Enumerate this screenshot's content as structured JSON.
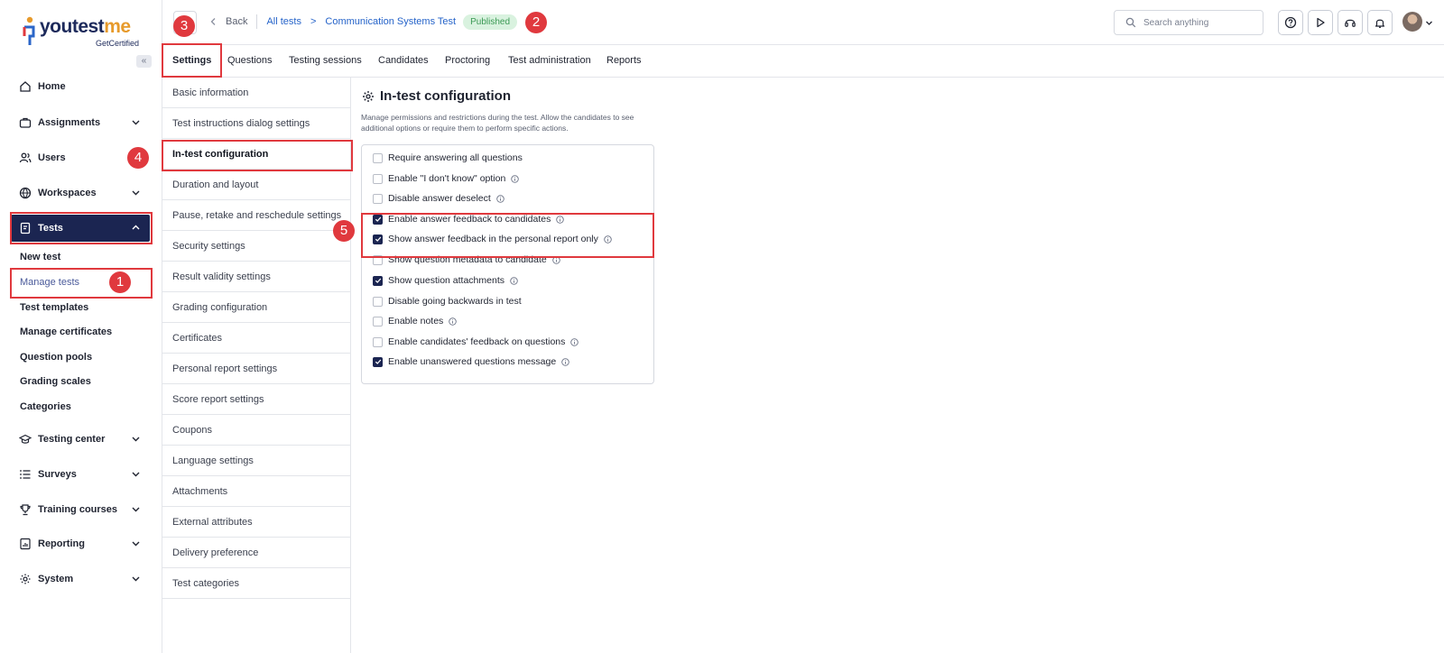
{
  "logo": {
    "brand_prefix": "youtest",
    "brand_suffix": "me",
    "tagline": "GetCertified"
  },
  "sidebar": {
    "collapse_symbol": "«",
    "items": [
      {
        "label": "Home",
        "icon": "home-icon"
      },
      {
        "label": "Assignments",
        "icon": "briefcase-icon"
      },
      {
        "label": "Users",
        "icon": "users-icon"
      },
      {
        "label": "Workspaces",
        "icon": "globe-icon"
      },
      {
        "label": "Tests",
        "icon": "document-icon"
      },
      {
        "label": "Testing center",
        "icon": "graduation-cap-icon"
      },
      {
        "label": "Surveys",
        "icon": "list-icon"
      },
      {
        "label": "Training courses",
        "icon": "trophy-icon"
      },
      {
        "label": "Reporting",
        "icon": "report-icon"
      },
      {
        "label": "System",
        "icon": "gear-icon"
      }
    ],
    "tests_sub": [
      "New test",
      "Manage tests",
      "Test templates",
      "Manage certificates",
      "Question pools",
      "Grading scales",
      "Categories"
    ]
  },
  "topbar": {
    "back": "Back",
    "crumb_all": "All tests",
    "crumb_sep": ">",
    "crumb_test": "Communication Systems Test",
    "status": "Published",
    "search_placeholder": "Search anything"
  },
  "tabs": [
    "Settings",
    "Questions",
    "Testing sessions",
    "Candidates",
    "Proctoring",
    "Test administration",
    "Reports"
  ],
  "settings_menu": [
    "Basic information",
    "Test instructions dialog settings",
    "In-test configuration",
    "Duration and layout",
    "Pause, retake and reschedule settings",
    "Security settings",
    "Result validity settings",
    "Grading configuration",
    "Certificates",
    "Personal report settings",
    "Score report settings",
    "Coupons",
    "Language settings",
    "Attachments",
    "External attributes",
    "Delivery preference",
    "Test categories"
  ],
  "content": {
    "title": "In-test configuration",
    "description": "Manage permissions and restrictions during the test. Allow the candidates to see additional options or require them to perform specific actions.",
    "options": [
      {
        "label": "Require answering all questions",
        "checked": false,
        "info": false
      },
      {
        "label": "Enable \"I don't know\" option",
        "checked": false,
        "info": true
      },
      {
        "label": "Disable answer deselect",
        "checked": false,
        "info": true
      },
      {
        "label": "Enable answer feedback to candidates",
        "checked": true,
        "info": true
      },
      {
        "label": "Show answer feedback in the personal report only",
        "checked": true,
        "info": true
      },
      {
        "label": "Show question metadata to candidate",
        "checked": false,
        "info": true
      },
      {
        "label": "Show question attachments",
        "checked": true,
        "info": true
      },
      {
        "label": "Disable going backwards in test",
        "checked": false,
        "info": false
      },
      {
        "label": "Enable notes",
        "checked": false,
        "info": true
      },
      {
        "label": "Enable candidates' feedback on questions",
        "checked": false,
        "info": true
      },
      {
        "label": "Enable unanswered questions message",
        "checked": true,
        "info": true
      }
    ]
  },
  "annotations": [
    "1",
    "2",
    "3",
    "4",
    "5"
  ],
  "colors": {
    "primary": "#1b2551",
    "link": "#2563c9",
    "published_bg": "#d9f2df",
    "published_text": "#3c9a55",
    "annotation": "#e0393e",
    "logo_accent": "#e79a2b"
  }
}
